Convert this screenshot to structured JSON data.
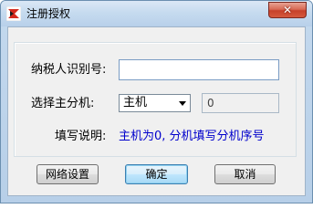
{
  "window": {
    "title": "注册授权",
    "close_label": "✕"
  },
  "form": {
    "taxpayer_label": "纳税人识别号:",
    "taxpayer_value": "",
    "host_select_label": "选择主分机:",
    "host_select_value": "主机",
    "machine_number": "0",
    "note_label": "填写说明:",
    "note_text": "主机为0, 分机填写分机序号"
  },
  "buttons": {
    "network": "网络设置",
    "ok": "确定",
    "cancel": "取消"
  },
  "colors": {
    "note": "#0000cc",
    "close_button": "#c7412a"
  }
}
